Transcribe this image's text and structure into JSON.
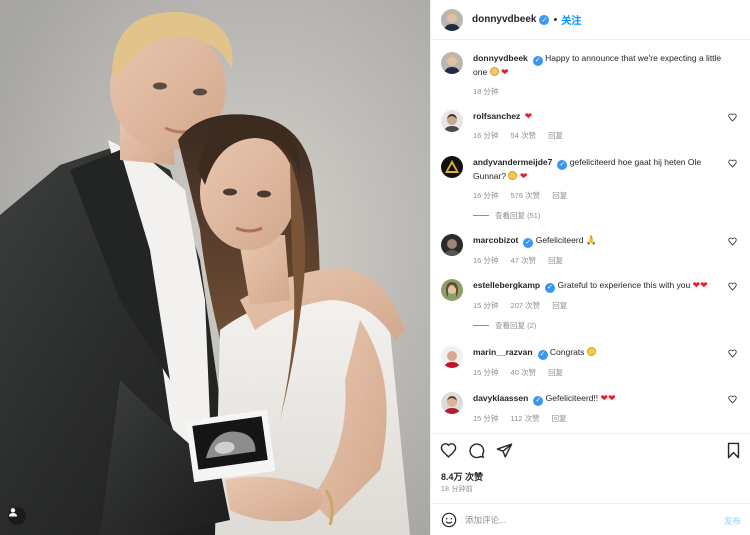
{
  "post": {
    "author": "donnyvdbeek",
    "follow_label": "关注",
    "dot": "•",
    "caption_text": "Happy to announce that we're expecting a little one",
    "caption_time": "18 分钟"
  },
  "comments": [
    {
      "username": "rolfsanchez",
      "text": "",
      "emojis": [
        "red-heart"
      ],
      "time": "16 分钟",
      "likes": "54 次赞",
      "reply": "回复",
      "replies": ""
    },
    {
      "username": "andyvandermeijde7",
      "text": "gefeliciteerd hoe gaat hij heten Ole Gunnar?",
      "emojis": [
        "laughing-face",
        "red-heart"
      ],
      "time": "16 分钟",
      "likes": "576 次赞",
      "reply": "回复",
      "replies": "查看回复 (51)"
    },
    {
      "username": "marcobizot",
      "text": "Gefeliciteerd",
      "emojis": [
        "folded-hands"
      ],
      "time": "16 分钟",
      "likes": "47 次赞",
      "reply": "回复",
      "replies": ""
    },
    {
      "username": "estellebergkamp",
      "text": "Grateful to experience this with you",
      "emojis": [
        "red-heart",
        "red-heart"
      ],
      "time": "15 分钟",
      "likes": "207 次赞",
      "reply": "回复",
      "replies": "查看回复 (2)"
    },
    {
      "username": "marin__razvan",
      "text": "Congrats",
      "emojis": [
        "heart-eyes-face"
      ],
      "time": "15 分钟",
      "likes": "40 次赞",
      "reply": "回复",
      "replies": ""
    },
    {
      "username": "davyklaassen",
      "text": "Gefeliciteerd!!",
      "emojis": [
        "red-heart",
        "red-heart"
      ],
      "time": "15 分钟",
      "likes": "112 次赞",
      "reply": "回复",
      "replies": ""
    }
  ],
  "actions": {
    "likes": "8.4万 次赞",
    "time_ago": "18 分钟前",
    "comment_placeholder": "添加评论...",
    "post_label": "发布"
  },
  "colors": {
    "link_blue": "#0095f6",
    "verified_blue": "#3897f0",
    "heart_red": "#ed1c2e",
    "muted_text": "#8e8e8e",
    "post_button_disabled": "#b2dffc"
  },
  "icons": {
    "like": "heart-outline-icon",
    "comment": "comment-bubble-icon",
    "share": "paper-plane-icon",
    "save": "bookmark-icon",
    "emoji": "smiley-icon",
    "tagged_user": "user-tag-icon"
  }
}
